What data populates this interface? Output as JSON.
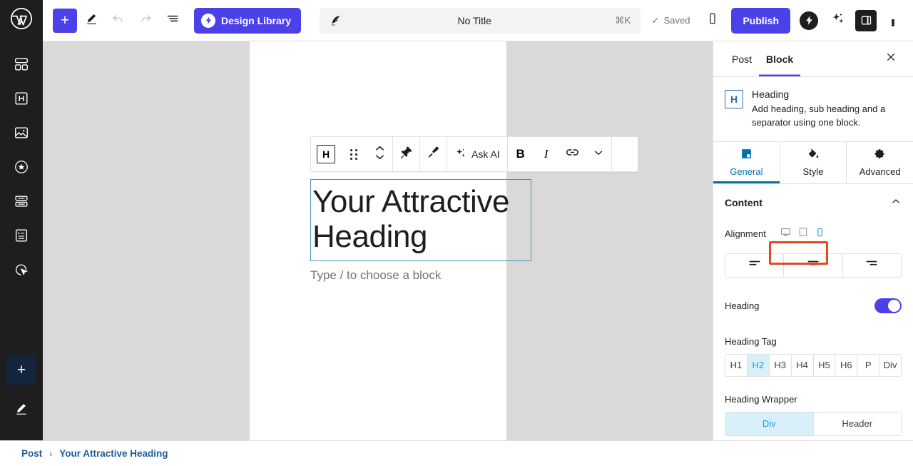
{
  "topbar": {
    "logo_icon": "wordpress-logo-icon",
    "add_block_label": "+",
    "edit_icon": "pencil-icon",
    "undo_icon": "undo-arrow-icon",
    "redo_icon": "redo-arrow-icon",
    "list_view_icon": "document-outline-icon",
    "design_library_label": "Design Library",
    "title_value": "No Title",
    "title_shortcut": "⌘K",
    "title_icon": "quill-pen-icon",
    "saved_label": "Saved",
    "saved_check": "✓",
    "preview_icon": "mobile-preview-icon",
    "publish_label": "Publish",
    "spectra_icon": "spectra-lightning-icon",
    "ai_icon": "sparkles-ai-icon",
    "settings_panel_icon": "sidebar-panel-icon",
    "more_icon": "kebab-menu-icon"
  },
  "left_rail": {
    "items": [
      {
        "icon": "layout-dashboard-icon",
        "name": "dashboard"
      },
      {
        "icon": "heading-h-icon",
        "name": "headings"
      },
      {
        "icon": "image-icon",
        "name": "media"
      },
      {
        "icon": "star-badge-icon",
        "name": "featured"
      },
      {
        "icon": "stacked-rows-icon",
        "name": "layout-blocks"
      },
      {
        "icon": "form-list-icon",
        "name": "forms"
      },
      {
        "icon": "cursor-click-icon",
        "name": "interactions"
      }
    ],
    "add_icon": "plus-icon",
    "add_label": "+",
    "pencil_icon": "pencil-icon"
  },
  "block_toolbar": {
    "block_type_letter": "H",
    "block_type_icon": "heading-block-icon",
    "drag_icon": "drag-handle-icon",
    "move_icon": "move-up-down-icon",
    "pin_icon": "pin-hammer-icon",
    "brush_icon": "paint-brush-icon",
    "ask_ai_label": "Ask AI",
    "ask_ai_icon": "sparkles-icon",
    "bold_label": "B",
    "italic_label": "I",
    "link_icon": "link-icon",
    "chevron_icon": "chevron-down-icon",
    "options_icon": "kebab-menu-icon"
  },
  "canvas": {
    "heading_text": "Your Attractive Heading",
    "paragraph_placeholder": "Type / to choose a block"
  },
  "right_panel": {
    "tabs": [
      {
        "label": "Post",
        "active": false
      },
      {
        "label": "Block",
        "active": true
      }
    ],
    "close_icon": "close-icon",
    "block": {
      "icon_letter": "H",
      "icon": "heading-block-icon",
      "title": "Heading",
      "description": "Add heading, sub heading and a separator using one block."
    },
    "setting_tabs": [
      {
        "label": "General",
        "icon": "general-square-icon",
        "active": true
      },
      {
        "label": "Style",
        "icon": "paint-bucket-icon",
        "active": false
      },
      {
        "label": "Advanced",
        "icon": "gear-icon",
        "active": false
      }
    ],
    "content_section": {
      "title": "Content",
      "collapse_icon": "chevron-up-icon"
    },
    "alignment": {
      "label": "Alignment",
      "devices": [
        {
          "name": "desktop",
          "icon": "desktop-monitor-icon",
          "active": false
        },
        {
          "name": "tablet",
          "icon": "tablet-icon",
          "active": false
        },
        {
          "name": "mobile",
          "icon": "mobile-phone-icon",
          "active": true
        }
      ],
      "options": [
        {
          "name": "align-left",
          "icon": "align-left-icon",
          "active": false
        },
        {
          "name": "align-center",
          "icon": "align-center-icon",
          "active": false
        },
        {
          "name": "align-right",
          "icon": "align-right-icon",
          "active": false
        }
      ]
    },
    "heading_toggle": {
      "label": "Heading",
      "enabled": true
    },
    "heading_tag": {
      "label": "Heading Tag",
      "options": [
        "H1",
        "H2",
        "H3",
        "H4",
        "H5",
        "H6",
        "P",
        "Div"
      ],
      "selected": "H2"
    },
    "heading_wrapper": {
      "label": "Heading Wrapper",
      "options": [
        "Div",
        "Header"
      ],
      "selected": "Div"
    }
  },
  "breadcrumb": {
    "items": [
      "Post",
      "Your Attractive Heading"
    ],
    "separator": "›"
  },
  "colors": {
    "brand_purple": "#4b41e8",
    "accent_blue": "#0073aa",
    "select_blue": "#d9f0fb",
    "highlight_orange": "#e8481f",
    "dark": "#1e1e1e"
  }
}
